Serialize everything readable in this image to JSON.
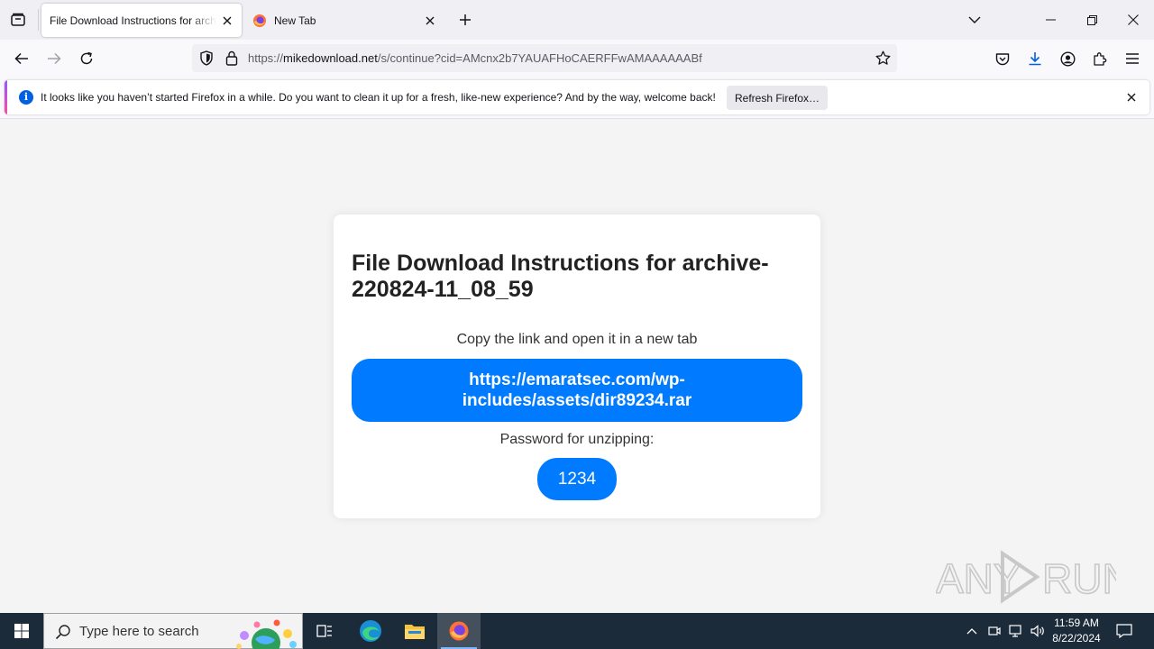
{
  "browser": {
    "tabs": [
      {
        "title": "File Download Instructions for archive-220824-11_08_59",
        "active": true
      },
      {
        "title": "New Tab",
        "active": false
      }
    ],
    "url": {
      "scheme": "https://",
      "domain": "mikedownload.net",
      "path": "/s/continue?cid=AMcnx2b7YAUAFHoCAERFFwAMAAAAAABf"
    },
    "notification": {
      "message": "It looks like you haven’t started Firefox in a while. Do you want to clean it up for a fresh, like-new experience? And by the way, welcome back!",
      "button_label": "Refresh Firefox…"
    }
  },
  "page": {
    "title": "File Download Instructions for archive-220824-11_08_59",
    "instruction": "Copy the link and open it in a new tab",
    "link": "https://emaratsec.com/wp-includes/assets/dir89234.rar",
    "password_label": "Password for unzipping:",
    "password": "1234"
  },
  "watermark": "ANY RUN",
  "taskbar": {
    "search_placeholder": "Type here to search",
    "time": "11:59 AM",
    "date": "8/22/2024",
    "pinned": [
      "task-view",
      "edge",
      "file-explorer",
      "firefox"
    ]
  },
  "colors": {
    "accent": "#007bff",
    "taskbar": "#1c2b3a",
    "firefox_info": "#0060df"
  }
}
